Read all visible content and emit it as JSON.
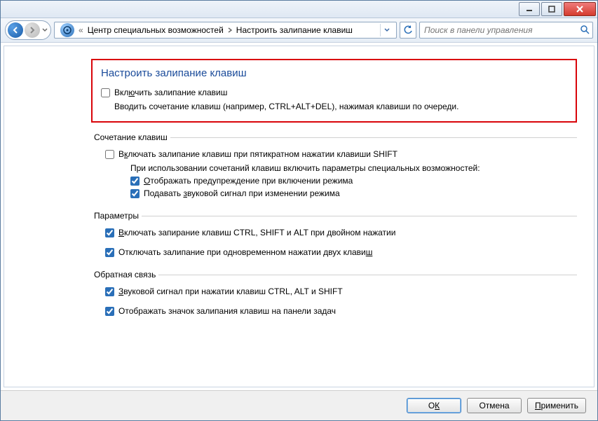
{
  "titlebar": {
    "min_tip": "Свернуть",
    "max_tip": "Развернуть",
    "close_tip": "Закрыть"
  },
  "nav": {
    "chevrons": "«",
    "crumb1": "Центр специальных возможностей",
    "crumb2": "Настроить залипание клавиш",
    "search_placeholder": "Поиск в панели управления"
  },
  "page": {
    "heading": "Настроить залипание клавиш",
    "enable_label_pre": "Вкл",
    "enable_label_u": "ю",
    "enable_label_post": "чить залипание клавиш",
    "enable_desc": "Вводить сочетание клавиш (например, CTRL+ALT+DEL), нажимая клавиши по очереди.",
    "enable_checked": false
  },
  "group_combo": {
    "legend": "Сочетание клавиш",
    "cb_shift_pre": "В",
    "cb_shift_u": "к",
    "cb_shift_post": "лючать залипание клавиш при пятикратном нажатии клавиши SHIFT",
    "cb_shift_checked": false,
    "subnote": "При использовании сочетаний клавиш включить параметры специальных возможностей:",
    "cb_warn_pre": "",
    "cb_warn_u": "О",
    "cb_warn_post": "тображать предупреждение при включении режима",
    "cb_warn_checked": true,
    "cb_sound_pre": "Подавать ",
    "cb_sound_u": "з",
    "cb_sound_post": "вуковой сигнал при изменении режима",
    "cb_sound_checked": true
  },
  "group_params": {
    "legend": "Параметры",
    "cb_lock_pre": "",
    "cb_lock_u": "В",
    "cb_lock_post": "ключать запирание клавиш CTRL, SHIFT и ALT при двойном нажатии",
    "cb_lock_checked": true,
    "cb_off_pre": "Отключать залипание при одновременном нажатии двух клави",
    "cb_off_u": "ш",
    "cb_off_post": "",
    "cb_off_checked": true
  },
  "group_feedback": {
    "legend": "Обратная связь",
    "cb_beep_pre": "",
    "cb_beep_u": "З",
    "cb_beep_post": "вуковой сигнал при нажатии клавиш CTRL, ALT и SHIFT",
    "cb_beep_checked": true,
    "cb_tray_pre": "Отображать значок залипания клавиш на панели задач",
    "cb_tray_u": "",
    "cb_tray_post": "",
    "cb_tray_checked": true
  },
  "buttons": {
    "ok_pre": "О",
    "ok_u": "К",
    "ok_post": "",
    "cancel": "Отмена",
    "apply_pre": "",
    "apply_u": "П",
    "apply_post": "рименить"
  }
}
